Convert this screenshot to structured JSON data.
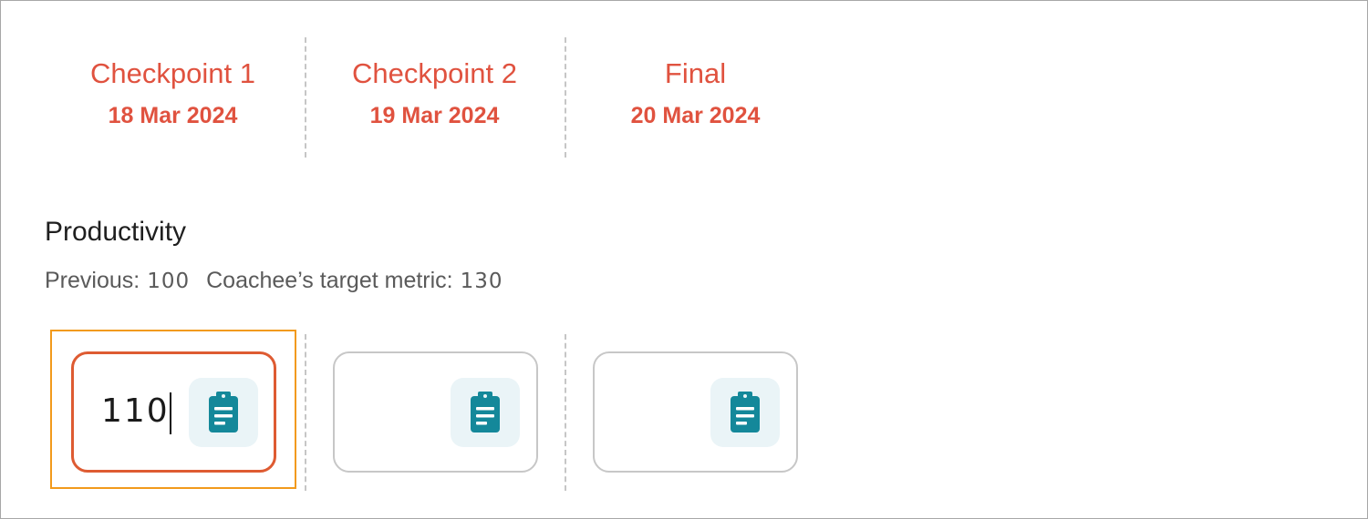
{
  "checkpoints": [
    {
      "name": "Checkpoint 1",
      "date": "18 Mar 2024"
    },
    {
      "name": "Checkpoint 2",
      "date": "19 Mar 2024"
    },
    {
      "name": "Final",
      "date": "20 Mar 2024"
    }
  ],
  "metric": {
    "title": "Productivity",
    "previous_label": "Previous:",
    "previous_value": "100",
    "target_label": "Coachee’s target metric:",
    "target_value": "130"
  },
  "inputs": [
    {
      "value": "110",
      "note_icon": "clipboard-icon"
    },
    {
      "value": "",
      "note_icon": "clipboard-icon"
    },
    {
      "value": "",
      "note_icon": "clipboard-icon"
    }
  ],
  "colors": {
    "accent": "#e0523f",
    "focus_outline": "#f29a1c",
    "active_border": "#de5b32",
    "icon_fill": "#14889a",
    "icon_bg": "#eaf4f7"
  }
}
